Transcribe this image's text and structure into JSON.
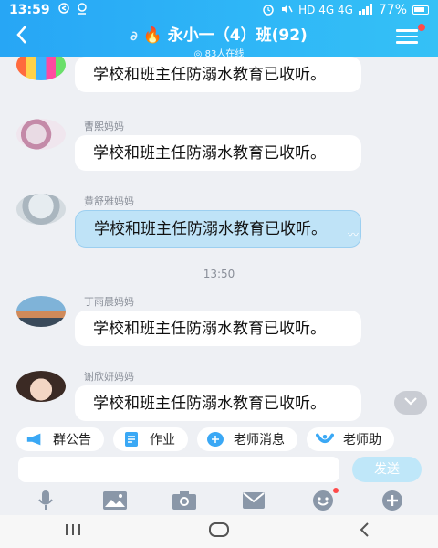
{
  "status_bar": {
    "time": "13:59",
    "network_labels": "HD 4G 4G",
    "battery": "77%"
  },
  "header": {
    "title": "永小一（4）班(92)",
    "online": "83人在线"
  },
  "messages": [
    {
      "sender": "",
      "text": "学校和班主任防溺水教育已收听。",
      "highlighted": false
    },
    {
      "sender": "曹熙妈妈",
      "text": "学校和班主任防溺水教育已收听。",
      "highlighted": false
    },
    {
      "sender": "黄舒雅妈妈",
      "text": "学校和班主任防溺水教育已收听。",
      "highlighted": true
    },
    {
      "sender": "丁雨晨妈妈",
      "text": "学校和班主任防溺水教育已收听。",
      "highlighted": false
    },
    {
      "sender": "谢欣妍妈妈",
      "text": "学校和班主任防溺水教育已收听。",
      "highlighted": false
    }
  ],
  "time_separator": "13:50",
  "shortcuts": [
    {
      "label": "群公告",
      "icon": "megaphone-icon"
    },
    {
      "label": "作业",
      "icon": "document-icon"
    },
    {
      "label": "老师消息",
      "icon": "teacher-badge-icon"
    },
    {
      "label": "老师助",
      "icon": "assistant-icon"
    }
  ],
  "input": {
    "placeholder": "",
    "send_label": "发送"
  },
  "toolbar": [
    "microphone-icon",
    "image-icon",
    "camera-icon",
    "envelope-icon",
    "emoji-icon",
    "plus-icon"
  ],
  "colors": {
    "accent": "#2fb2f6",
    "send_disabled": "#bfe7f9",
    "highlight_bubble": "#bfe3f7"
  }
}
